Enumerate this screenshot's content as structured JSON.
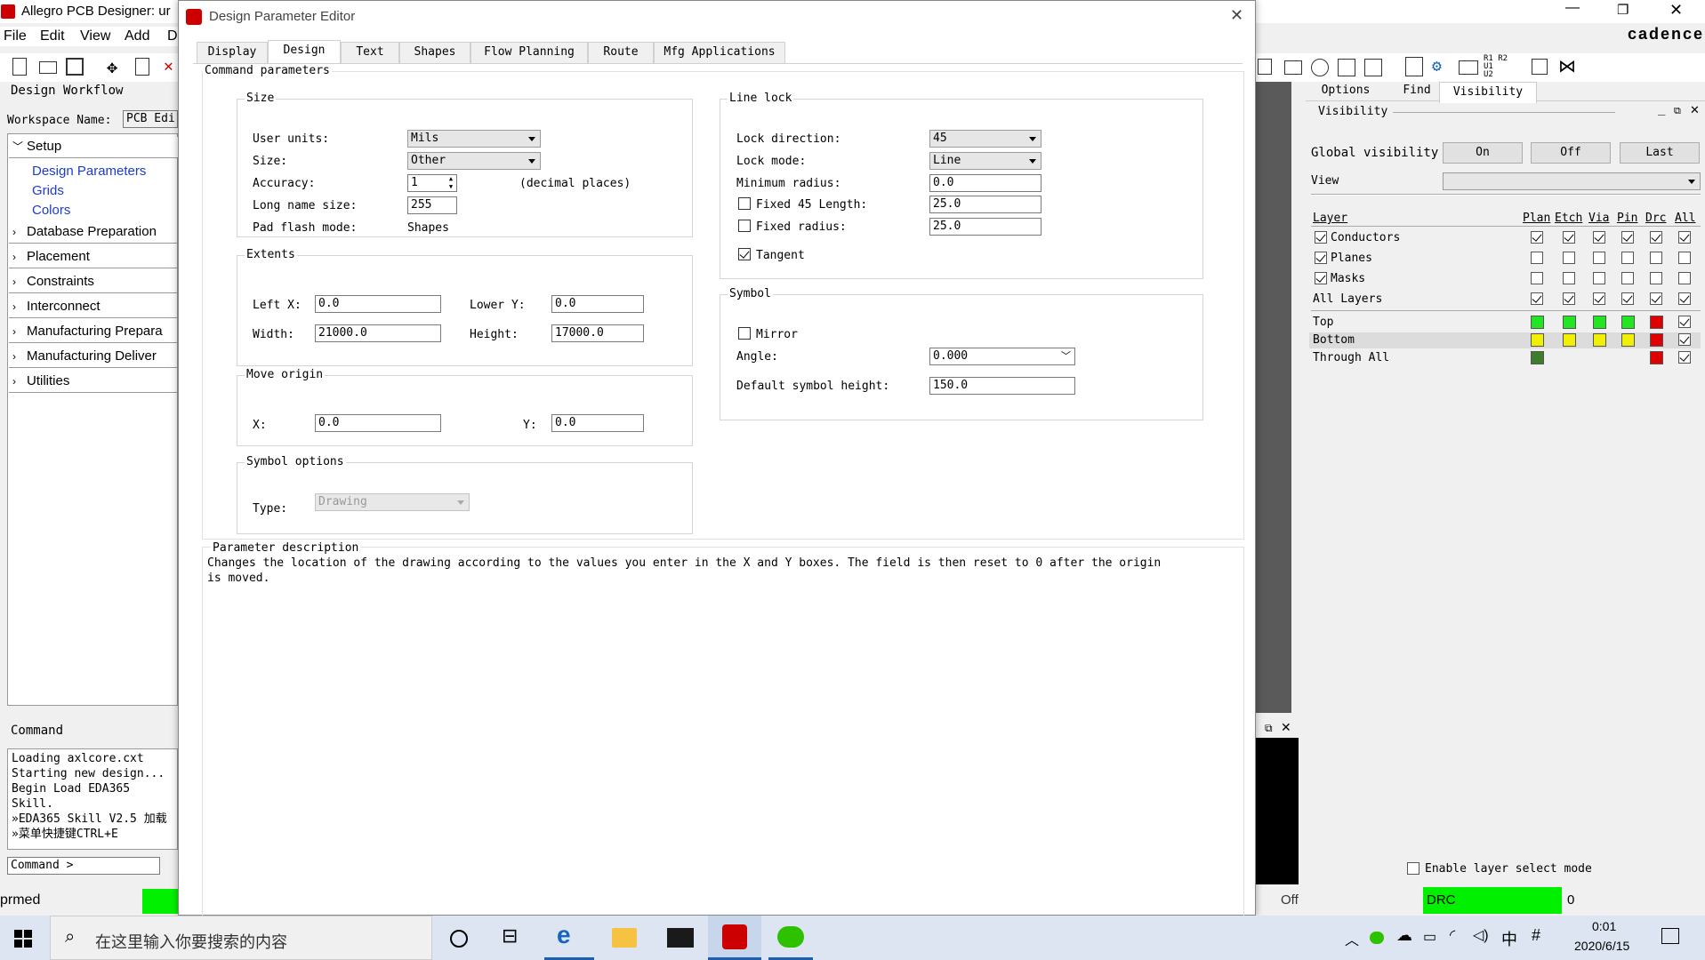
{
  "app": {
    "title": "Allegro PCB Designer: ur",
    "menu": [
      "File",
      "Edit",
      "View",
      "Add",
      "D"
    ],
    "brand": "cadence",
    "status_left": "prmed"
  },
  "workflow": {
    "title": "Design Workflow",
    "workspace_label": "Workspace Name:",
    "workspace_value": "PCB Edi",
    "setup": "Setup",
    "setup_items": [
      "Design Parameters",
      "Grids",
      "Colors"
    ],
    "sections": [
      "Database Preparation",
      "Placement",
      "Constraints",
      "Interconnect",
      "Manufacturing Prepara",
      "Manufacturing Deliver",
      "Utilities"
    ]
  },
  "command": {
    "title": "Command",
    "log": [
      "Loading axlcore.cxt",
      "Starting new design...",
      "Begin Load EDA365 Skill.",
      "»EDA365 Skill V2.5 加载",
      "»菜单快捷键CTRL+E"
    ],
    "prompt": "Command >"
  },
  "dialog": {
    "title": "Design Parameter Editor",
    "tabs": [
      "Display",
      "Design",
      "Text",
      "Shapes",
      "Flow Planning",
      "Route",
      "Mfg Applications"
    ],
    "command_params": "Command parameters",
    "size": {
      "title": "Size",
      "user_units_label": "User units:",
      "user_units": "Mils",
      "size_label": "Size:",
      "size": "Other",
      "accuracy_label": "Accuracy:",
      "accuracy": "1",
      "accuracy_note": "(decimal places)",
      "long_name_label": "Long name size:",
      "long_name": "255",
      "pad_flash_label": "Pad flash mode:",
      "pad_flash": "Shapes"
    },
    "extents": {
      "title": "Extents",
      "left_x_label": "Left X:",
      "left_x": "0.0",
      "lower_y_label": "Lower Y:",
      "lower_y": "0.0",
      "width_label": "Width:",
      "width": "21000.0",
      "height_label": "Height:",
      "height": "17000.0"
    },
    "move_origin": {
      "title": "Move origin",
      "x_label": "X:",
      "x": "0.0",
      "y_label": "Y:",
      "y": "0.0"
    },
    "symbol_options": {
      "title": "Symbol options",
      "type_label": "Type:",
      "type": "Drawing"
    },
    "line_lock": {
      "title": "Line lock",
      "lock_dir_label": "Lock direction:",
      "lock_dir": "45",
      "lock_mode_label": "Lock mode:",
      "lock_mode": "Line",
      "min_radius_label": "Minimum radius:",
      "min_radius": "0.0",
      "fixed45_label": "Fixed 45 Length:",
      "fixed45": "25.0",
      "fixed_radius_label": "Fixed radius:",
      "fixed_radius": "25.0",
      "tangent_label": "Tangent"
    },
    "symbol": {
      "title": "Symbol",
      "mirror_label": "Mirror",
      "angle_label": "Angle:",
      "angle": "0.000",
      "height_label": "Default symbol height:",
      "height": "150.0"
    },
    "param_desc": {
      "title": "Parameter description",
      "line1": "Changes the location of the drawing according to the values you enter in the X and Y boxes. The field is then reset to 0 after the origin",
      "line2": "is moved."
    }
  },
  "visibility": {
    "tabs": [
      "Options",
      "Find",
      "Visibility"
    ],
    "title": "Visibility",
    "global_label": "Global visibility",
    "on": "On",
    "off": "Off",
    "last": "Last",
    "view_label": "View",
    "cols": [
      "Plan",
      "Etch",
      "Via",
      "Pin",
      "Drc",
      "All"
    ],
    "layer_label": "Layer",
    "rows": [
      "Conductors",
      "Planes",
      "Masks",
      "All Layers"
    ],
    "layers": [
      "Top",
      "Bottom",
      "Through All"
    ],
    "enable_label": "Enable layer select mode",
    "status_off": "Off",
    "drc": "DRC",
    "drc_count": "0",
    "colors": {
      "green": "#22e622",
      "yellow": "#f0f000",
      "red": "#e00000",
      "olive": "#3e7d2c"
    }
  },
  "taskbar": {
    "search": "在这里输入你要搜索的内容",
    "time": "0:01",
    "date": "2020/6/15",
    "ime": "中"
  }
}
